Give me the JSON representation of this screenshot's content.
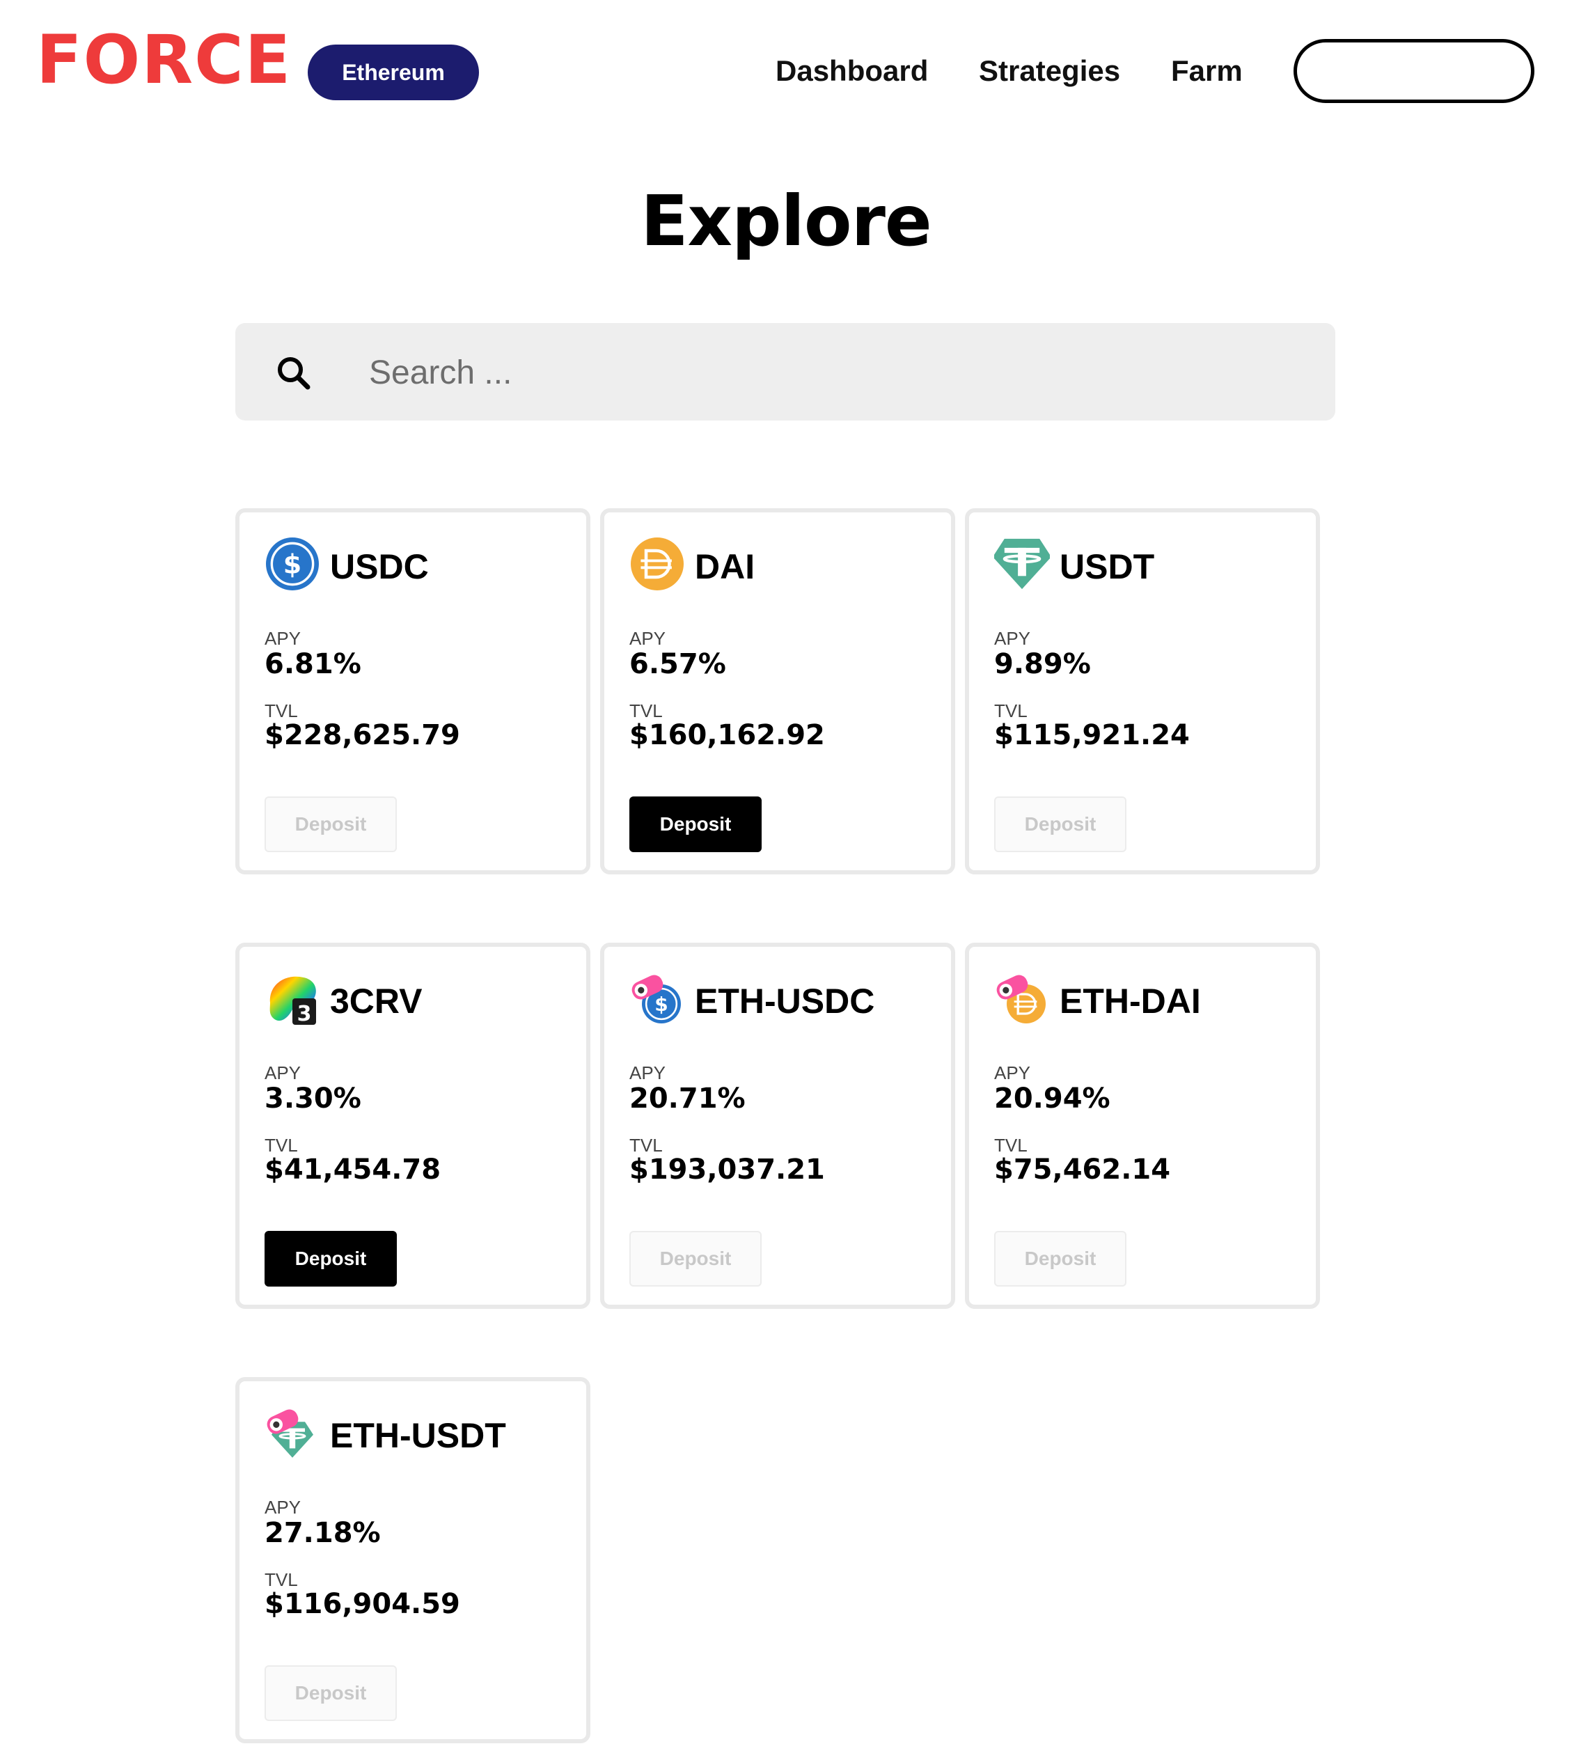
{
  "header": {
    "logo": "FORCE",
    "network": "Ethereum",
    "nav": [
      "Dashboard",
      "Strategies",
      "Farm"
    ],
    "wallet_label": ""
  },
  "page": {
    "title": "Explore"
  },
  "search": {
    "placeholder": "Search ...",
    "value": ""
  },
  "colors": {
    "brand": "#ee3b3b",
    "network_pill": "#1c1c6e",
    "card_border": "#e9e9e9",
    "search_bg": "#eeeeee",
    "usdc": "#2775ca",
    "dai": "#f5ac37",
    "usdt": "#50af95",
    "sushi": "#fa52a0"
  },
  "vaults": [
    {
      "name": "USDC",
      "icon": "usdc-icon",
      "apy_label": "APY",
      "apy": "6.81%",
      "tvl_label": "TVL",
      "tvl": "$228,625.79",
      "deposit_label": "Deposit",
      "deposit_enabled": false
    },
    {
      "name": "DAI",
      "icon": "dai-icon",
      "apy_label": "APY",
      "apy": "6.57%",
      "tvl_label": "TVL",
      "tvl": "$160,162.92",
      "deposit_label": "Deposit",
      "deposit_enabled": true
    },
    {
      "name": "USDT",
      "icon": "usdt-icon",
      "apy_label": "APY",
      "apy": "9.89%",
      "tvl_label": "TVL",
      "tvl": "$115,921.24",
      "deposit_label": "Deposit",
      "deposit_enabled": false
    },
    {
      "name": "3CRV",
      "icon": "curve-3crv-icon",
      "apy_label": "APY",
      "apy": "3.30%",
      "tvl_label": "TVL",
      "tvl": "$41,454.78",
      "deposit_label": "Deposit",
      "deposit_enabled": true
    },
    {
      "name": "ETH-USDC",
      "icon": "sushi-usdc-icon",
      "apy_label": "APY",
      "apy": "20.71%",
      "tvl_label": "TVL",
      "tvl": "$193,037.21",
      "deposit_label": "Deposit",
      "deposit_enabled": false
    },
    {
      "name": "ETH-DAI",
      "icon": "sushi-dai-icon",
      "apy_label": "APY",
      "apy": "20.94%",
      "tvl_label": "TVL",
      "tvl": "$75,462.14",
      "deposit_label": "Deposit",
      "deposit_enabled": false
    },
    {
      "name": "ETH-USDT",
      "icon": "sushi-usdt-icon",
      "apy_label": "APY",
      "apy": "27.18%",
      "tvl_label": "TVL",
      "tvl": "$116,904.59",
      "deposit_label": "Deposit",
      "deposit_enabled": false
    }
  ]
}
